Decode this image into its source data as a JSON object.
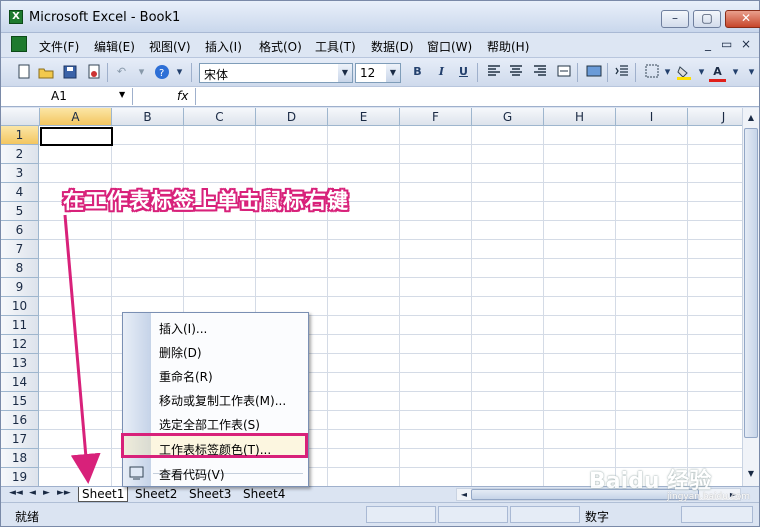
{
  "window": {
    "title": "Microsoft Excel - Book1",
    "app_icon": "X"
  },
  "window_controls": {
    "minimize": "–",
    "maximize": "▢",
    "close": "✕"
  },
  "menu": {
    "items": [
      "文件(F)",
      "编辑(E)",
      "视图(V)",
      "插入(I)",
      "格式(O)",
      "工具(T)",
      "数据(D)",
      "窗口(W)",
      "帮助(H)"
    ],
    "mdi_min": "_",
    "mdi_restore": "▭",
    "mdi_close": "×"
  },
  "toolbar": {
    "font_name": "宋体",
    "font_size": "12",
    "bold": "B",
    "italic": "I",
    "underline": "U",
    "font_color_label": "A"
  },
  "formula_bar": {
    "name_box": "A1",
    "fx": "fx",
    "content": ""
  },
  "grid": {
    "columns": [
      "A",
      "B",
      "C",
      "D",
      "E",
      "F",
      "G",
      "H",
      "I",
      "J"
    ],
    "rows": [
      "1",
      "2",
      "3",
      "4",
      "5",
      "6",
      "7",
      "8",
      "9",
      "10",
      "11",
      "12",
      "13",
      "14",
      "15",
      "16",
      "17",
      "18",
      "19"
    ],
    "selected_cell": "A1"
  },
  "annotation": "在工作表标签上单击鼠标右键",
  "context_menu": {
    "items": [
      "插入(I)...",
      "删除(D)",
      "重命名(R)",
      "移动或复制工作表(M)...",
      "选定全部工作表(S)",
      "工作表标签颜色(T)...",
      "查看代码(V)"
    ],
    "highlighted": "工作表标签颜色(T)..."
  },
  "sheet_tabs": [
    "Sheet1",
    "Sheet2",
    "Sheet3",
    "Sheet4"
  ],
  "tab_nav": [
    "◄◄",
    "◄",
    "►",
    "►►"
  ],
  "status": {
    "ready": "就绪",
    "mode": "数字"
  },
  "watermark": {
    "brand": "Baidu 经验",
    "sub": "jingyan.baidu.com"
  },
  "colors": {
    "accent": "#d8217a",
    "title_bg": "#dbe4f2",
    "header_sel": "#f3c660"
  }
}
